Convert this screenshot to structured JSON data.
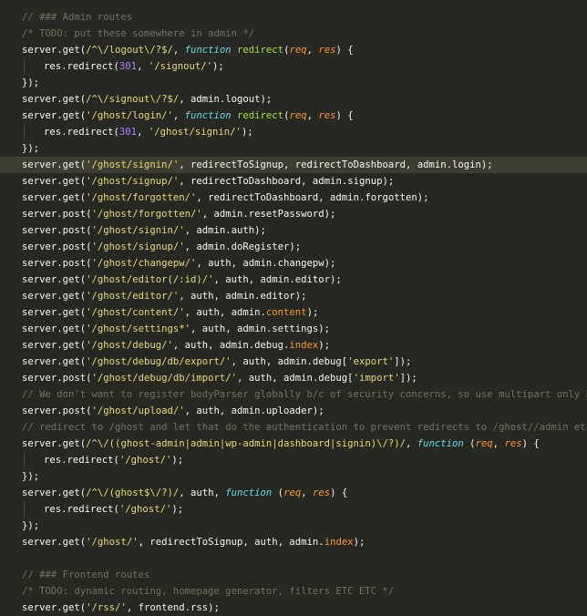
{
  "editor": {
    "lines": [
      {
        "tokens": [
          {
            "t": "// ### Admin routes",
            "c": "comment"
          }
        ]
      },
      {
        "tokens": [
          {
            "t": "/* TODO: put these somewhere in admin */",
            "c": "comment"
          }
        ]
      },
      {
        "tokens": [
          {
            "t": "server.get(",
            "c": "plain"
          },
          {
            "t": "/^\\/logout\\/?$/",
            "c": "string"
          },
          {
            "t": ", ",
            "c": "plain"
          },
          {
            "t": "function",
            "c": "keyword"
          },
          {
            "t": " ",
            "c": "plain"
          },
          {
            "t": "redirect",
            "c": "func"
          },
          {
            "t": "(",
            "c": "plain"
          },
          {
            "t": "req",
            "c": "param"
          },
          {
            "t": ", ",
            "c": "plain"
          },
          {
            "t": "res",
            "c": "param"
          },
          {
            "t": ") {",
            "c": "plain"
          }
        ]
      },
      {
        "indent": true,
        "tokens": [
          {
            "t": "res.redirect(",
            "c": "plain"
          },
          {
            "t": "301",
            "c": "number"
          },
          {
            "t": ", ",
            "c": "plain"
          },
          {
            "t": "'/signout/'",
            "c": "string"
          },
          {
            "t": ");",
            "c": "plain"
          }
        ]
      },
      {
        "tokens": [
          {
            "t": "});",
            "c": "plain"
          }
        ]
      },
      {
        "tokens": [
          {
            "t": "server.get(",
            "c": "plain"
          },
          {
            "t": "/^\\/signout\\/?$/",
            "c": "string"
          },
          {
            "t": ", admin.logout);",
            "c": "plain"
          }
        ]
      },
      {
        "tokens": [
          {
            "t": "server.get(",
            "c": "plain"
          },
          {
            "t": "'/ghost/login/'",
            "c": "string"
          },
          {
            "t": ", ",
            "c": "plain"
          },
          {
            "t": "function",
            "c": "keyword"
          },
          {
            "t": " ",
            "c": "plain"
          },
          {
            "t": "redirect",
            "c": "func"
          },
          {
            "t": "(",
            "c": "plain"
          },
          {
            "t": "req",
            "c": "param"
          },
          {
            "t": ", ",
            "c": "plain"
          },
          {
            "t": "res",
            "c": "param"
          },
          {
            "t": ") {",
            "c": "plain"
          }
        ]
      },
      {
        "indent": true,
        "tokens": [
          {
            "t": "res.redirect(",
            "c": "plain"
          },
          {
            "t": "301",
            "c": "number"
          },
          {
            "t": ", ",
            "c": "plain"
          },
          {
            "t": "'/ghost/signin/'",
            "c": "string"
          },
          {
            "t": ");",
            "c": "plain"
          }
        ]
      },
      {
        "tokens": [
          {
            "t": "});",
            "c": "plain"
          }
        ]
      },
      {
        "highlight": true,
        "tokens": [
          {
            "t": "server.get(",
            "c": "plain"
          },
          {
            "t": "'/ghost/signin/'",
            "c": "string"
          },
          {
            "t": ", redirectToSignup, redirectToDashboard, admin.login);",
            "c": "plain"
          }
        ]
      },
      {
        "tokens": [
          {
            "t": "server.get(",
            "c": "plain"
          },
          {
            "t": "'/ghost/signup/'",
            "c": "string"
          },
          {
            "t": ", redirectToDashboard, admin.signup);",
            "c": "plain"
          }
        ]
      },
      {
        "tokens": [
          {
            "t": "server.get(",
            "c": "plain"
          },
          {
            "t": "'/ghost/forgotten/'",
            "c": "string"
          },
          {
            "t": ", redirectToDashboard, admin.forgotten);",
            "c": "plain"
          }
        ]
      },
      {
        "tokens": [
          {
            "t": "server.post(",
            "c": "plain"
          },
          {
            "t": "'/ghost/forgotten/'",
            "c": "string"
          },
          {
            "t": ", admin.resetPassword);",
            "c": "plain"
          }
        ]
      },
      {
        "tokens": [
          {
            "t": "server.post(",
            "c": "plain"
          },
          {
            "t": "'/ghost/signin/'",
            "c": "string"
          },
          {
            "t": ", admin.auth);",
            "c": "plain"
          }
        ]
      },
      {
        "tokens": [
          {
            "t": "server.post(",
            "c": "plain"
          },
          {
            "t": "'/ghost/signup/'",
            "c": "string"
          },
          {
            "t": ", admin.doRegister);",
            "c": "plain"
          }
        ]
      },
      {
        "tokens": [
          {
            "t": "server.post(",
            "c": "plain"
          },
          {
            "t": "'/ghost/changepw/'",
            "c": "string"
          },
          {
            "t": ", auth, admin.changepw);",
            "c": "plain"
          }
        ]
      },
      {
        "tokens": [
          {
            "t": "server.get(",
            "c": "plain"
          },
          {
            "t": "'/ghost/editor(/:id)/'",
            "c": "string"
          },
          {
            "t": ", auth, admin.editor);",
            "c": "plain"
          }
        ]
      },
      {
        "tokens": [
          {
            "t": "server.get(",
            "c": "plain"
          },
          {
            "t": "'/ghost/editor/'",
            "c": "string"
          },
          {
            "t": ", auth, admin.editor);",
            "c": "plain"
          }
        ]
      },
      {
        "tokens": [
          {
            "t": "server.get(",
            "c": "plain"
          },
          {
            "t": "'/ghost/content/'",
            "c": "string"
          },
          {
            "t": ", auth, admin.",
            "c": "plain"
          },
          {
            "t": "content",
            "c": "prop"
          },
          {
            "t": ");",
            "c": "plain"
          }
        ]
      },
      {
        "tokens": [
          {
            "t": "server.get(",
            "c": "plain"
          },
          {
            "t": "'/ghost/settings*'",
            "c": "string"
          },
          {
            "t": ", auth, admin.settings);",
            "c": "plain"
          }
        ]
      },
      {
        "tokens": [
          {
            "t": "server.get(",
            "c": "plain"
          },
          {
            "t": "'/ghost/debug/'",
            "c": "string"
          },
          {
            "t": ", auth, admin.debug.",
            "c": "plain"
          },
          {
            "t": "index",
            "c": "prop"
          },
          {
            "t": ");",
            "c": "plain"
          }
        ]
      },
      {
        "tokens": [
          {
            "t": "server.get(",
            "c": "plain"
          },
          {
            "t": "'/ghost/debug/db/export/'",
            "c": "string"
          },
          {
            "t": ", auth, admin.debug[",
            "c": "plain"
          },
          {
            "t": "'export'",
            "c": "string"
          },
          {
            "t": "]);",
            "c": "plain"
          }
        ]
      },
      {
        "tokens": [
          {
            "t": "server.post(",
            "c": "plain"
          },
          {
            "t": "'/ghost/debug/db/import/'",
            "c": "string"
          },
          {
            "t": ", auth, admin.debug[",
            "c": "plain"
          },
          {
            "t": "'import'",
            "c": "string"
          },
          {
            "t": "]);",
            "c": "plain"
          }
        ]
      },
      {
        "tokens": [
          {
            "t": "// We don't want to register bodyParser globally b/c of security concerns, so use multipart only here",
            "c": "comment"
          }
        ]
      },
      {
        "tokens": [
          {
            "t": "server.post(",
            "c": "plain"
          },
          {
            "t": "'/ghost/upload/'",
            "c": "string"
          },
          {
            "t": ", auth, admin.uploader);",
            "c": "plain"
          }
        ]
      },
      {
        "tokens": [
          {
            "t": "// redirect to /ghost and let that do the authentication to prevent redirects to /ghost//admin etc.",
            "c": "comment"
          }
        ]
      },
      {
        "tokens": [
          {
            "t": "server.get(",
            "c": "plain"
          },
          {
            "t": "/^\\/((ghost-admin|admin|wp-admin|dashboard|signin)\\/?)/",
            "c": "string"
          },
          {
            "t": ", ",
            "c": "plain"
          },
          {
            "t": "function",
            "c": "keyword"
          },
          {
            "t": " (",
            "c": "plain"
          },
          {
            "t": "req",
            "c": "param"
          },
          {
            "t": ", ",
            "c": "plain"
          },
          {
            "t": "res",
            "c": "param"
          },
          {
            "t": ") {",
            "c": "plain"
          }
        ]
      },
      {
        "indent": true,
        "tokens": [
          {
            "t": "res.redirect(",
            "c": "plain"
          },
          {
            "t": "'/ghost/'",
            "c": "string"
          },
          {
            "t": ");",
            "c": "plain"
          }
        ]
      },
      {
        "tokens": [
          {
            "t": "});",
            "c": "plain"
          }
        ]
      },
      {
        "tokens": [
          {
            "t": "server.get(",
            "c": "plain"
          },
          {
            "t": "/^\\/(ghost$\\/?)/",
            "c": "string"
          },
          {
            "t": ", auth, ",
            "c": "plain"
          },
          {
            "t": "function",
            "c": "keyword"
          },
          {
            "t": " (",
            "c": "plain"
          },
          {
            "t": "req",
            "c": "param"
          },
          {
            "t": ", ",
            "c": "plain"
          },
          {
            "t": "res",
            "c": "param"
          },
          {
            "t": ") {",
            "c": "plain"
          }
        ]
      },
      {
        "indent": true,
        "tokens": [
          {
            "t": "res.redirect(",
            "c": "plain"
          },
          {
            "t": "'/ghost/'",
            "c": "string"
          },
          {
            "t": ");",
            "c": "plain"
          }
        ]
      },
      {
        "tokens": [
          {
            "t": "});",
            "c": "plain"
          }
        ]
      },
      {
        "tokens": [
          {
            "t": "server.get(",
            "c": "plain"
          },
          {
            "t": "'/ghost/'",
            "c": "string"
          },
          {
            "t": ", redirectToSignup, auth, admin.",
            "c": "plain"
          },
          {
            "t": "index",
            "c": "prop"
          },
          {
            "t": ");",
            "c": "plain"
          }
        ]
      },
      {
        "tokens": []
      },
      {
        "tokens": [
          {
            "t": "// ### Frontend routes",
            "c": "comment"
          }
        ]
      },
      {
        "tokens": [
          {
            "t": "/* TODO: dynamic routing, homepage generator, filters ETC ETC */",
            "c": "comment"
          }
        ]
      },
      {
        "tokens": [
          {
            "t": "server.get(",
            "c": "plain"
          },
          {
            "t": "'/rss/'",
            "c": "string"
          },
          {
            "t": ", frontend.rss);",
            "c": "plain"
          }
        ]
      }
    ]
  }
}
